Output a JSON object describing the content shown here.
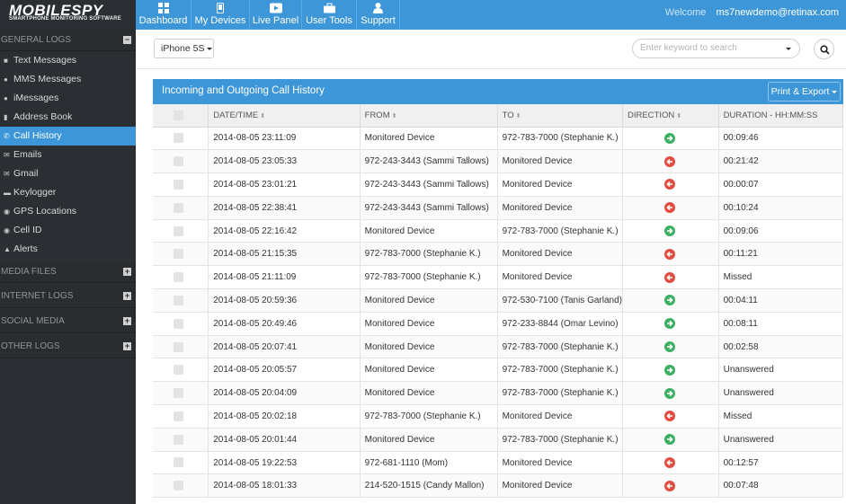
{
  "logo": {
    "main": "MOBILESPY",
    "tagline": "SMARTPHONE MONITORING SOFTWARE"
  },
  "nav": [
    {
      "label": "Dashboard",
      "icon": "dashboard-icon"
    },
    {
      "label": "My Devices",
      "icon": "phone-icon"
    },
    {
      "label": "Live Panel",
      "icon": "play-icon"
    },
    {
      "label": "User Tools",
      "icon": "briefcase-icon"
    },
    {
      "label": "Support",
      "icon": "user-icon"
    }
  ],
  "welcome": {
    "label": "Welcome",
    "email": "ms7newdemo@retinax.com"
  },
  "sidebar": {
    "general_logs": "GENERAL LOGS",
    "items": [
      {
        "label": "Text Messages",
        "icon": "chat-icon"
      },
      {
        "label": "MMS Messages",
        "icon": "camera-icon"
      },
      {
        "label": "iMessages",
        "icon": "apple-icon"
      },
      {
        "label": "Address Book",
        "icon": "book-icon"
      },
      {
        "label": "Call History",
        "icon": "phone-icon"
      },
      {
        "label": "Emails",
        "icon": "envelope-icon"
      },
      {
        "label": "Gmail",
        "icon": "mail-icon"
      },
      {
        "label": "Keylogger",
        "icon": "keyboard-icon"
      },
      {
        "label": "GPS Locations",
        "icon": "pin-icon"
      },
      {
        "label": "Cell ID",
        "icon": "location-icon"
      },
      {
        "label": "Alerts",
        "icon": "warning-icon"
      }
    ],
    "sections": [
      "MEDIA FILES",
      "INTERNET LOGS",
      "SOCIAL MEDIA",
      "OTHER LOGS"
    ]
  },
  "device_select": "iPhone 5S",
  "search": {
    "placeholder": "Enter keyword to search"
  },
  "panel": {
    "title": "Incoming and Outgoing Call History",
    "export_label": "Print & Export"
  },
  "table": {
    "columns": [
      "DATE/TIME",
      "FROM",
      "TO",
      "DIRECTION",
      "DURATION - HH:MM:SS"
    ],
    "rows": [
      {
        "datetime": "2014-08-05 23:11:09",
        "from": "Monitored Device",
        "to": "972-783-7000 (Stephanie K.)",
        "direction": "outgoing",
        "duration": "00:09:46"
      },
      {
        "datetime": "2014-08-05 23:05:33",
        "from": "972-243-3443 (Sammi Tallows)",
        "to": "Monitored Device",
        "direction": "incoming",
        "duration": "00:21:42"
      },
      {
        "datetime": "2014-08-05 23:01:21",
        "from": "972-243-3443 (Sammi Tallows)",
        "to": "Monitored Device",
        "direction": "incoming",
        "duration": "00:00:07"
      },
      {
        "datetime": "2014-08-05 22:38:41",
        "from": "972-243-3443 (Sammi Tallows)",
        "to": "Monitored Device",
        "direction": "incoming",
        "duration": "00:10:24"
      },
      {
        "datetime": "2014-08-05 22:16:42",
        "from": "Monitored Device",
        "to": "972-783-7000 (Stephanie K.)",
        "direction": "outgoing",
        "duration": "00:09:06"
      },
      {
        "datetime": "2014-08-05 21:15:35",
        "from": "972-783-7000 (Stephanie K.)",
        "to": "Monitored Device",
        "direction": "incoming",
        "duration": "00:11:21"
      },
      {
        "datetime": "2014-08-05 21:11:09",
        "from": "972-783-7000 (Stephanie K.)",
        "to": "Monitored Device",
        "direction": "incoming",
        "duration": "Missed"
      },
      {
        "datetime": "2014-08-05 20:59:36",
        "from": "Monitored Device",
        "to": "972-530-7100 (Tanis Garland)",
        "direction": "outgoing",
        "duration": "00:04:11"
      },
      {
        "datetime": "2014-08-05 20:49:46",
        "from": "Monitored Device",
        "to": "972-233-8844 (Omar Levino)",
        "direction": "outgoing",
        "duration": "00:08:11"
      },
      {
        "datetime": "2014-08-05 20:07:41",
        "from": "Monitored Device",
        "to": "972-783-7000 (Stephanie K.)",
        "direction": "outgoing",
        "duration": "00:02:58"
      },
      {
        "datetime": "2014-08-05 20:05:57",
        "from": "Monitored Device",
        "to": "972-783-7000 (Stephanie K.)",
        "direction": "outgoing",
        "duration": "Unanswered"
      },
      {
        "datetime": "2014-08-05 20:04:09",
        "from": "Monitored Device",
        "to": "972-783-7000 (Stephanie K.)",
        "direction": "outgoing",
        "duration": "Unanswered"
      },
      {
        "datetime": "2014-08-05 20:02:18",
        "from": "972-783-7000 (Stephanie K.)",
        "to": "Monitored Device",
        "direction": "incoming",
        "duration": "Missed"
      },
      {
        "datetime": "2014-08-05 20:01:44",
        "from": "Monitored Device",
        "to": "972-783-7000 (Stephanie K.)",
        "direction": "outgoing",
        "duration": "Unanswered"
      },
      {
        "datetime": "2014-08-05 19:22:53",
        "from": "972-681-1110 (Mom)",
        "to": "Monitored Device",
        "direction": "incoming",
        "duration": "00:12:57"
      },
      {
        "datetime": "2014-08-05 18:01:33",
        "from": "214-520-1515 (Candy Mallon)",
        "to": "Monitored Device",
        "direction": "incoming",
        "duration": "00:07:48"
      }
    ]
  },
  "colors": {
    "accent": "#3c96d7",
    "sidebar_bg": "#2b2f33",
    "outgoing": "#3bb062",
    "incoming": "#e24b3e"
  }
}
